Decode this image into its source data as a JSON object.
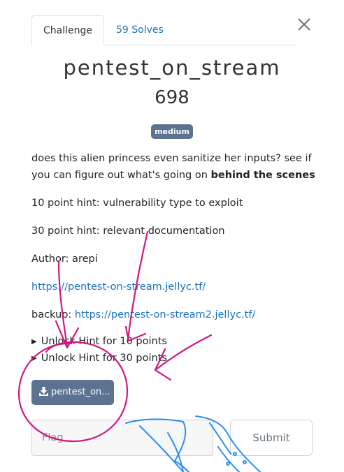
{
  "tabs": {
    "challenge": "Challenge",
    "solves": "59 Solves"
  },
  "challenge": {
    "name": "pentest_on_stream",
    "value": "698",
    "difficulty": "medium",
    "description_part1": "does this alien princess even sanitize her inputs? see if you can figure out what's going on ",
    "description_bold": "behind the scenes",
    "hint_10": "10 point hint: vulnerability type to exploit",
    "hint_30": "30 point hint: relevant documentation",
    "author": "Author: arepi",
    "url": "https://pentest-on-stream.jellyc.tf/",
    "backup_label": "backup: ",
    "backup_url": "https://pentest-on-stream2.jellyc.tf/"
  },
  "hints": {
    "unlock_10": "Unlock Hint for 10 points",
    "unlock_30": "Unlock Hint for 30 points"
  },
  "file": {
    "name": "pentest_on..."
  },
  "submission": {
    "placeholder": "Flag",
    "submit_label": "Submit"
  },
  "colors": {
    "accent": "#1b73bf",
    "badge": "#5b7290",
    "annotation_pink": "#d0187f",
    "annotation_blue": "#2d8ff0"
  }
}
